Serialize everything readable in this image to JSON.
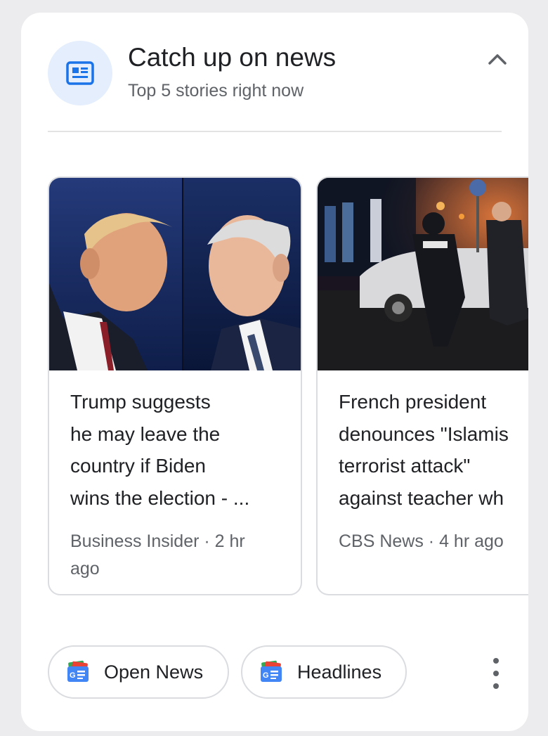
{
  "header": {
    "title": "Catch up on news",
    "subtitle": "Top 5 stories right now",
    "icon": "newspaper-icon",
    "collapse_icon": "chevron-up-icon"
  },
  "stories": [
    {
      "headline": "Trump suggests\nhe may leave the\ncountry if Biden\nwins the election - ...",
      "source": "Business Insider",
      "time": "2 hr ago",
      "meta": "Business Insider · 2 hr ago",
      "image": "debate-photo"
    },
    {
      "headline": "French president\ndenounces \"Islamis\nterrorist attack\"\nagainst teacher wh",
      "source": "CBS News",
      "time": "4 hr ago",
      "meta": "CBS News · 4 hr ago",
      "image": "police-scene-photo"
    }
  ],
  "actions": {
    "open_news": "Open News",
    "headlines": "Headlines",
    "more_icon": "more-vert-icon"
  },
  "colors": {
    "accent_blue": "#1a73e8",
    "icon_bg": "#e4eefc",
    "text_primary": "#202124",
    "text_secondary": "#5f6368"
  }
}
